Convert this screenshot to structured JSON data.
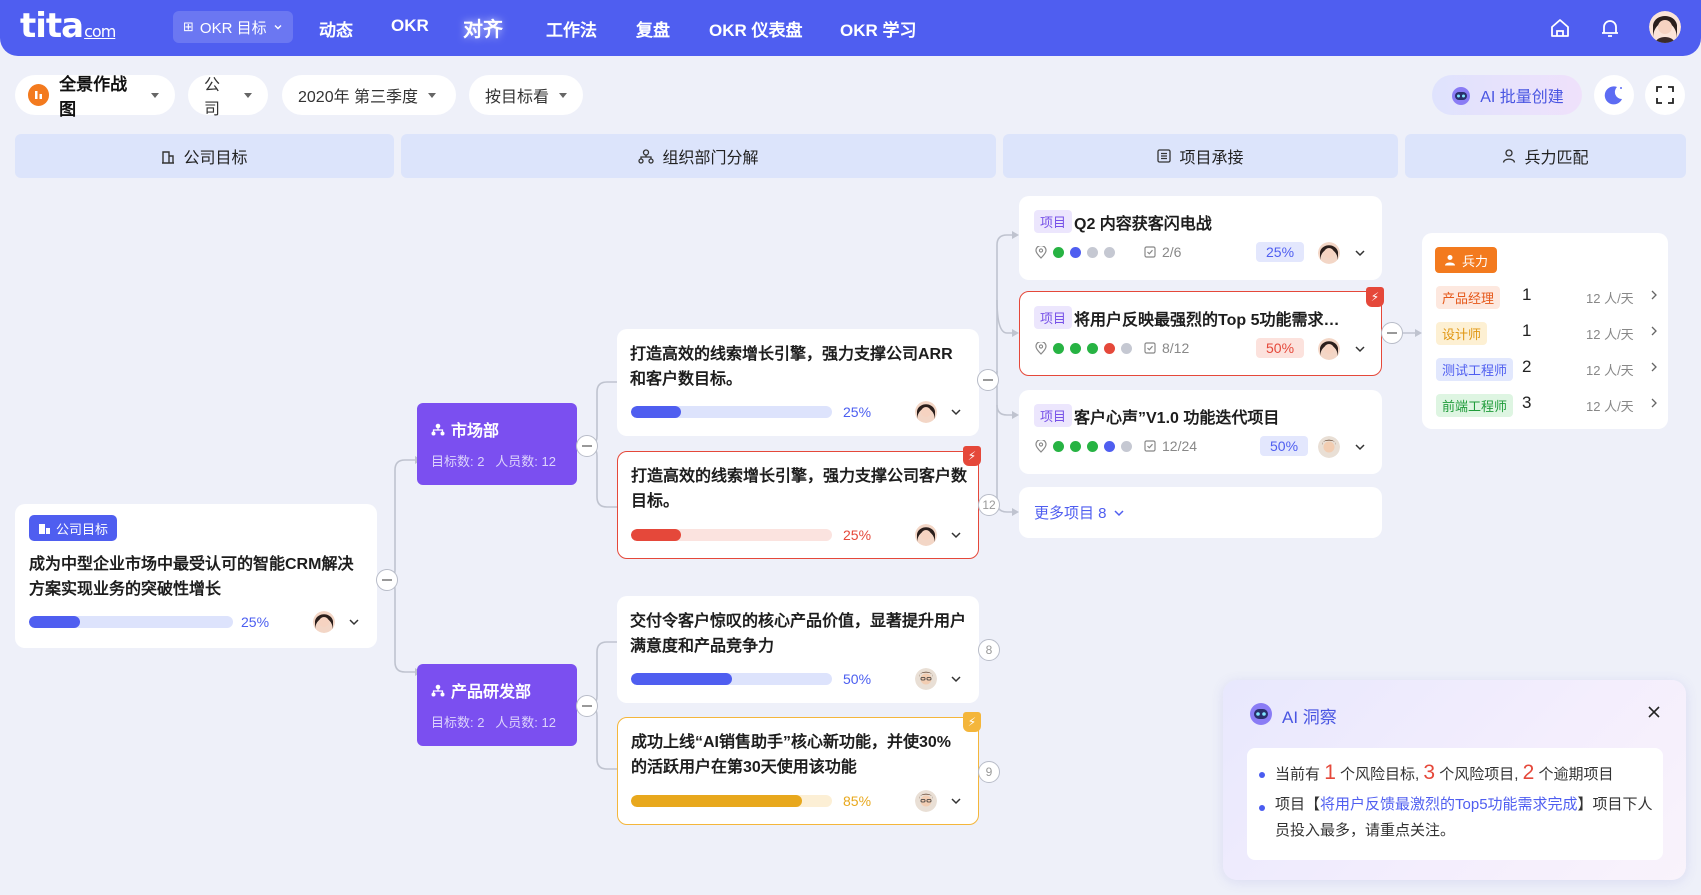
{
  "nav": {
    "logo_main": "tita",
    "logo_suffix": "com",
    "okr_selector": "OKR 目标",
    "links": [
      "动态",
      "OKR",
      "对齐",
      "工作法",
      "复盘",
      "OKR 仪表盘",
      "OKR 学习"
    ],
    "active": "对齐",
    "icons": [
      "home-icon",
      "bell-icon",
      "user-avatar"
    ]
  },
  "filters": {
    "view": "全景作战图",
    "scope": "公司",
    "period": "2020年 第三季度",
    "mode": "按目标看",
    "ai_batch": "AI 批量创建"
  },
  "columns": [
    "公司目标",
    "组织部门分解",
    "项目承接",
    "兵力匹配"
  ],
  "company_goal": {
    "tag": "公司目标",
    "title": "成为中型企业市场中最受认可的智能CRM解决方案实现业务的突破性增长",
    "progress": 25,
    "progress_label": "25%"
  },
  "departments": [
    {
      "name": "市场部",
      "stats": "目标数: 2   人员数: 12"
    },
    {
      "name": "产品研发部",
      "stats": "目标数: 2   人员数: 12"
    }
  ],
  "dept_goals": [
    {
      "title": "打造高效的线索增长引擎，强力支撑公司ARR和客户数目标。",
      "progress": 25,
      "label": "25%",
      "status": "normal",
      "count": ""
    },
    {
      "title": "打造高效的线索增长引擎，强力支撑公司客户数目标。",
      "progress": 25,
      "label": "25%",
      "status": "risk",
      "count": "12"
    },
    {
      "title": "交付令客户惊叹的核心产品价值，显著提升用户满意度和产品竞争力",
      "progress": 50,
      "label": "50%",
      "status": "normal",
      "count": "8"
    },
    {
      "title": "成功上线“AI销售助手”核心新功能，并使30%的活跃用户在第30天使用该功能",
      "progress": 85,
      "label": "85%",
      "status": "warn",
      "count": "9"
    }
  ],
  "projects": [
    {
      "tag": "项目",
      "title": "Q2 内容获客闪电战",
      "tasks": "2/6",
      "pct": "25%",
      "status": "normal"
    },
    {
      "tag": "项目",
      "title": "将用户反映最强烈的Top 5功能需求…",
      "tasks": "8/12",
      "pct": "50%",
      "status": "risk"
    },
    {
      "tag": "项目",
      "title": "客户心声”V1.0 功能迭代项目",
      "tasks": "12/24",
      "pct": "50%",
      "status": "normal"
    }
  ],
  "more_projects": "更多项目 8",
  "forces": {
    "title": "兵力",
    "roles": [
      {
        "name": "产品经理",
        "count": "1",
        "value": "12 人/天"
      },
      {
        "name": "设计师",
        "count": "1",
        "value": "12 人/天"
      },
      {
        "name": "测试工程师",
        "count": "2",
        "value": "12 人/天"
      },
      {
        "name": "前端工程师",
        "count": "3",
        "value": "12 人/天"
      }
    ]
  },
  "insight": {
    "title": "AI 洞察",
    "line1": {
      "a": "当前有",
      "n1": "1",
      "b": "个风险目标,",
      "n2": "3",
      "c": "个风险项目,",
      "n3": "2",
      "d": "个逾期项目"
    },
    "line2": {
      "a": "项目【",
      "link": "将用户反馈最激烈的Top5功能需求完成",
      "b": "】项目下人员投入最多，请重点关注。"
    }
  },
  "colors": {
    "primary": "#4f5ef0",
    "dept": "#7b4ff0",
    "risk": "#e5483a",
    "warn": "#f4b63b",
    "ok": "#27b343"
  }
}
